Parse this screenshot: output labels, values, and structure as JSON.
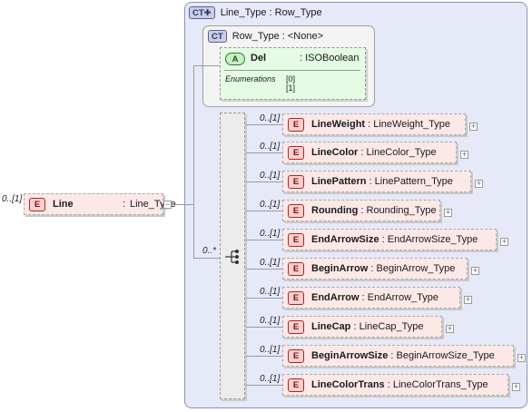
{
  "root": {
    "occurs": "0..[1]",
    "badge": "E",
    "name": "Line",
    "type_sep": ":",
    "type": "Line_Type",
    "collapse_glyph": "−"
  },
  "complex_type": {
    "badge": "CT",
    "header": "Line_Type : Row_Type"
  },
  "base_type": {
    "badge": "CT",
    "header": "Row_Type : <None>",
    "attribute": {
      "badge": "A",
      "name": "Del",
      "type": ": ISOBoolean"
    },
    "enumerations_label": "Enumerations",
    "enumerations": [
      "[0]",
      "[1]"
    ]
  },
  "sequence": {
    "occurs": "0..*",
    "icon": "sequence-icon"
  },
  "children": [
    {
      "occurs": "0..[1]",
      "badge": "E",
      "name": "LineWeight",
      "type": " : LineWeight_Type"
    },
    {
      "occurs": "0..[1]",
      "badge": "E",
      "name": "LineColor",
      "type": " : LineColor_Type"
    },
    {
      "occurs": "0..[1]",
      "badge": "E",
      "name": "LinePattern",
      "type": " : LinePattern_Type"
    },
    {
      "occurs": "0..[1]",
      "badge": "E",
      "name": "Rounding",
      "type": " : Rounding_Type"
    },
    {
      "occurs": "0..[1]",
      "badge": "E",
      "name": "EndArrowSize",
      "type": " : EndArrowSize_Type"
    },
    {
      "occurs": "0..[1]",
      "badge": "E",
      "name": "BeginArrow",
      "type": " : BeginArrow_Type"
    },
    {
      "occurs": "0..[1]",
      "badge": "E",
      "name": "EndArrow",
      "type": " : EndArrow_Type"
    },
    {
      "occurs": "0..[1]",
      "badge": "E",
      "name": "LineCap",
      "type": " : LineCap_Type"
    },
    {
      "occurs": "0..[1]",
      "badge": "E",
      "name": "BeginArrowSize",
      "type": " : BeginArrowSize_Type"
    },
    {
      "occurs": "0..[1]",
      "badge": "E",
      "name": "LineColorTrans",
      "type": " : LineColorTrans_Type"
    }
  ],
  "expand_glyph": "+",
  "colors": {
    "element_fill": "#fde8e8",
    "element_border": "#b02323",
    "complex_type_fill": "#e6e9f7",
    "base_type_fill": "#f4f4f4",
    "attribute_fill": "#e4fbe4"
  }
}
